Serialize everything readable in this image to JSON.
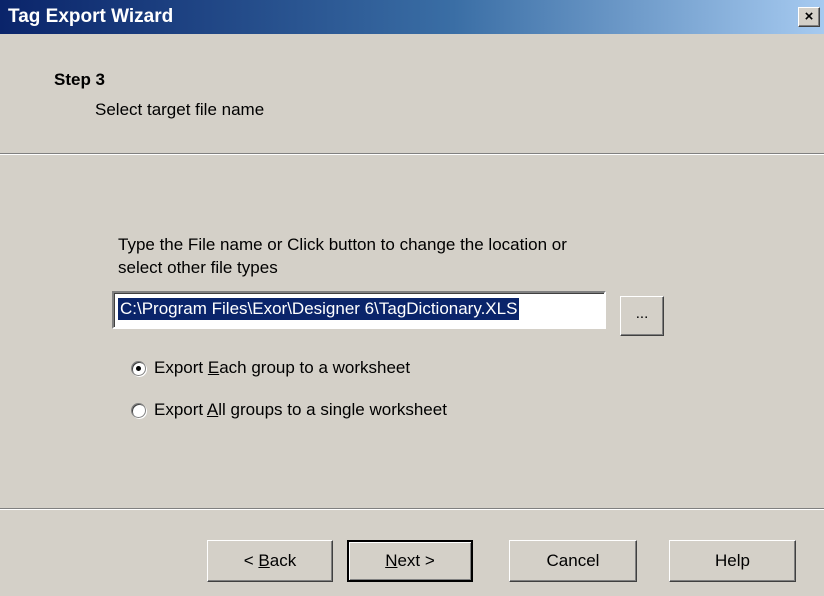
{
  "window": {
    "title": "Tag Export Wizard",
    "close_label": "×"
  },
  "header": {
    "step_title": "Step 3",
    "step_subtitle": "Select target file name"
  },
  "main": {
    "instruction": "Type the File name or Click button to change the location or select other file types",
    "file_path": "C:\\Program Files\\Exor\\Designer 6\\TagDictionary.XLS",
    "browse_label": "...",
    "options": [
      {
        "pre": "Export ",
        "key": "E",
        "post": "ach group to a worksheet",
        "checked": true
      },
      {
        "pre": "Export ",
        "key": "A",
        "post": "ll groups to a single worksheet",
        "checked": false
      }
    ]
  },
  "buttons": {
    "back": {
      "pre": "< ",
      "key": "B",
      "post": "ack"
    },
    "next": {
      "pre": "",
      "key": "N",
      "post": "ext >"
    },
    "cancel": "Cancel",
    "help": "Help"
  }
}
